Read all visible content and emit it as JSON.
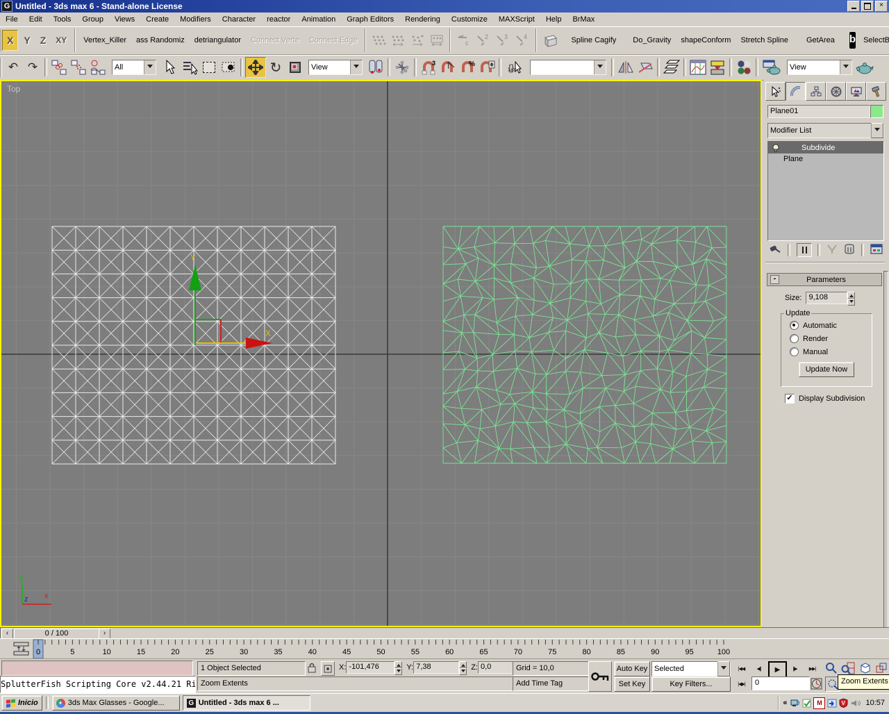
{
  "window": {
    "title": "Untitled - 3ds max 6 - Stand-alone License",
    "close_glyph": "×",
    "app_glyph": "G"
  },
  "menu": {
    "items": [
      "File",
      "Edit",
      "Tools",
      "Group",
      "Views",
      "Create",
      "Modifiers",
      "Character",
      "reactor",
      "Animation",
      "Graph Editors",
      "Rendering",
      "Customize",
      "MAXScript",
      "Help",
      "BrMax"
    ]
  },
  "axis_toolbar": {
    "x": "X",
    "y": "Y",
    "z": "Z",
    "xy": "XY",
    "active": "X"
  },
  "script_buttons": {
    "left": [
      "Vertex_Killer",
      "ass Randomiz",
      "detriangulator"
    ],
    "disabled": [
      "Connect Verte",
      "Connect Edge"
    ],
    "c_label": "c",
    "numbers": [
      "2",
      "3",
      "4"
    ],
    "right": [
      "Spline Cagify",
      "Do_Gravity",
      "shapeConform",
      "Stretch Spline",
      "GetArea"
    ],
    "logo_glyph": "b",
    "last": "SelectByEdge"
  },
  "main_toolbar": {
    "undo_glyph": "↶",
    "redo_glyph": "↷",
    "rotate_glyph": "↻",
    "filter_dropdown": "All",
    "coord_dropdown": "View",
    "render_dropdown": "View",
    "named_sets_value": "",
    "braces": "{}",
    "abc": "ABC",
    "snap3_label": "3",
    "percent_label": "%"
  },
  "viewport": {
    "label": "Top",
    "gizmo": {
      "x_label": "X",
      "y_label": "Y"
    },
    "axis": {
      "x": "x",
      "y": "y",
      "z": "z"
    }
  },
  "command_panel": {
    "object_name": "Plane01",
    "modifier_list": "Modifier List",
    "stack": {
      "selected": "Subdivide",
      "base": "Plane"
    },
    "rollout_title": "Parameters",
    "minus": "-",
    "size_label": "Size:",
    "size_value": "9,108",
    "update": {
      "title": "Update",
      "options": [
        "Automatic",
        "Render",
        "Manual"
      ],
      "selected": "Automatic",
      "button": "Update Now"
    },
    "display_subdivision": "Display Subdivision",
    "checkmark": "✓"
  },
  "timeline": {
    "slider": "0 / 100",
    "prev_glyph": "‹",
    "next_glyph": "›",
    "frames": 100,
    "current": 0,
    "tick_labels": [
      0,
      5,
      10,
      15,
      20,
      25,
      30,
      35,
      40,
      45,
      50,
      55,
      60,
      65,
      70,
      75,
      80,
      85,
      90,
      95,
      100
    ]
  },
  "status": {
    "listener": "SplutterFish Scripting Core v2.44.21 Ri",
    "selected": "1 Object Selected",
    "prompt": "Zoom Extents",
    "x_label": "X:",
    "x": "-101,476",
    "y_label": "Y:",
    "y": "7,38",
    "z_label": "Z:",
    "z": "0,0",
    "grid": "Grid = 10,0",
    "add_time_tag": "Add Time Tag",
    "auto_key": "Auto Key",
    "set_key": "Set Key",
    "key_dropdown": "Selected",
    "key_filters": "Key Filters...",
    "frame": "0",
    "tooltip": "Zoom Extents",
    "playback": {
      "start": "|◀◀",
      "prev": "◀||",
      "play": "▶",
      "next": "||▶",
      "end": "▶▶|",
      "key_step": "|◀▶|"
    }
  },
  "taskbar": {
    "start": "Inicio",
    "task1": "3ds Max Glasses - Google...",
    "task2": "Untitled - 3ds max 6 ...",
    "chevron": "«",
    "tray_m": "M",
    "tray_v": "V",
    "clock": "10:57"
  },
  "colors": {
    "active_tool": "#e9c341",
    "viewport_border": "#fbf400",
    "viewport_bg": "#7d7d7d",
    "plane_wire": "#ececec",
    "subdivided_wire": "#7be495",
    "titlebar_blue": "#16318e",
    "status_pink": "#dfc2c2",
    "swatch_green": "#8ce88c",
    "stack_selected_bg": "#6a6a6a"
  }
}
